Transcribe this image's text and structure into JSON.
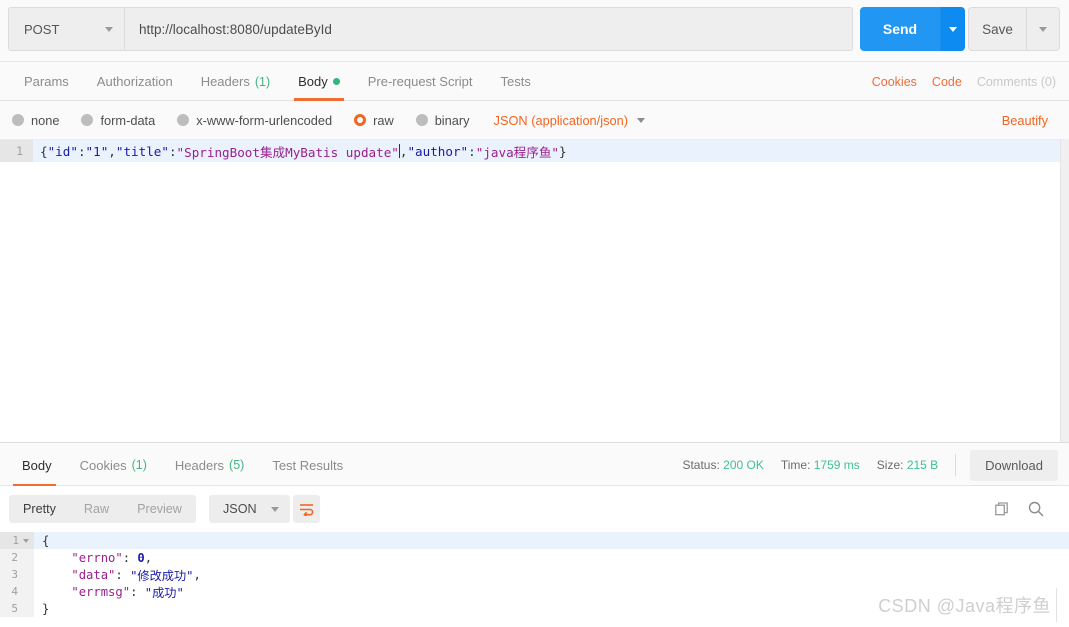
{
  "request": {
    "method": "POST",
    "url": "http://localhost:8080/updateById",
    "send_label": "Send",
    "save_label": "Save",
    "tabs": [
      {
        "label": "Params",
        "count": "",
        "active": false,
        "dot": false
      },
      {
        "label": "Authorization",
        "count": "",
        "active": false,
        "dot": false
      },
      {
        "label": "Headers",
        "count": "(1)",
        "active": false,
        "dot": false
      },
      {
        "label": "Body",
        "count": "",
        "active": true,
        "dot": true
      },
      {
        "label": "Pre-request Script",
        "count": "",
        "active": false,
        "dot": false
      },
      {
        "label": "Tests",
        "count": "",
        "active": false,
        "dot": false
      }
    ],
    "links": {
      "cookies": "Cookies",
      "code": "Code",
      "comments": "Comments (0)"
    },
    "body_types": [
      {
        "label": "none",
        "selected": false
      },
      {
        "label": "form-data",
        "selected": false
      },
      {
        "label": "x-www-form-urlencoded",
        "selected": false
      },
      {
        "label": "raw",
        "selected": true
      },
      {
        "label": "binary",
        "selected": false
      }
    ],
    "content_type": "JSON (application/json)",
    "beautify_label": "Beautify",
    "editor": {
      "line_number": "1",
      "segments": [
        {
          "text": "{",
          "color": "plain"
        },
        {
          "text": "\"id\"",
          "color": "blue"
        },
        {
          "text": ":",
          "color": "plain"
        },
        {
          "text": "\"1\"",
          "color": "blue"
        },
        {
          "text": ",",
          "color": "plain"
        },
        {
          "text": "\"title\"",
          "color": "blue"
        },
        {
          "text": ":",
          "color": "plain"
        },
        {
          "text": "\"SpringBoot集成MyBatis update\"",
          "color": "purple"
        },
        {
          "text": ",",
          "color": "plain"
        },
        {
          "text": "\"author\"",
          "color": "blue"
        },
        {
          "text": ":",
          "color": "plain"
        },
        {
          "text": "\"java程序鱼\"",
          "color": "purple"
        },
        {
          "text": "}",
          "color": "plain"
        }
      ],
      "raw_text": "{\"id\":\"1\",\"title\":\"SpringBoot集成MyBatis update\",\"author\":\"java程序鱼\"}"
    }
  },
  "response": {
    "tabs": [
      {
        "label": "Body",
        "count": "",
        "active": true
      },
      {
        "label": "Cookies",
        "count": "(1)",
        "active": false
      },
      {
        "label": "Headers",
        "count": "(5)",
        "active": false
      },
      {
        "label": "Test Results",
        "count": "",
        "active": false
      }
    ],
    "meta": {
      "status_label": "Status:",
      "status_value": "200 OK",
      "time_label": "Time:",
      "time_value": "1759 ms",
      "size_label": "Size:",
      "size_value": "215 B",
      "download_label": "Download"
    },
    "view_modes": [
      {
        "label": "Pretty",
        "active": true
      },
      {
        "label": "Raw",
        "active": false
      },
      {
        "label": "Preview",
        "active": false
      }
    ],
    "format": "JSON",
    "icons": {
      "wrap": "word-wrap-icon",
      "copy": "copy-icon",
      "search": "search-icon"
    },
    "body_lines": [
      {
        "n": "1",
        "fold": true,
        "parts": [
          {
            "text": "{",
            "color": "plain"
          }
        ]
      },
      {
        "n": "2",
        "fold": false,
        "parts": [
          {
            "text": "    ",
            "color": "plain"
          },
          {
            "text": "\"errno\"",
            "color": "key"
          },
          {
            "text": ": ",
            "color": "plain"
          },
          {
            "text": "0",
            "color": "num"
          },
          {
            "text": ",",
            "color": "plain"
          }
        ]
      },
      {
        "n": "3",
        "fold": false,
        "parts": [
          {
            "text": "    ",
            "color": "plain"
          },
          {
            "text": "\"data\"",
            "color": "key"
          },
          {
            "text": ": ",
            "color": "plain"
          },
          {
            "text": "\"修改成功\"",
            "color": "val"
          },
          {
            "text": ",",
            "color": "plain"
          }
        ]
      },
      {
        "n": "4",
        "fold": false,
        "parts": [
          {
            "text": "    ",
            "color": "plain"
          },
          {
            "text": "\"errmsg\"",
            "color": "key"
          },
          {
            "text": ": ",
            "color": "plain"
          },
          {
            "text": "\"成功\"",
            "color": "val"
          }
        ]
      },
      {
        "n": "5",
        "fold": false,
        "parts": [
          {
            "text": "}",
            "color": "plain"
          }
        ]
      }
    ]
  },
  "watermark": "CSDN @Java程序鱼",
  "colors": {
    "accent_orange": "#f26522",
    "send_blue": "#2296f3",
    "status_green": "#3ec28f"
  }
}
